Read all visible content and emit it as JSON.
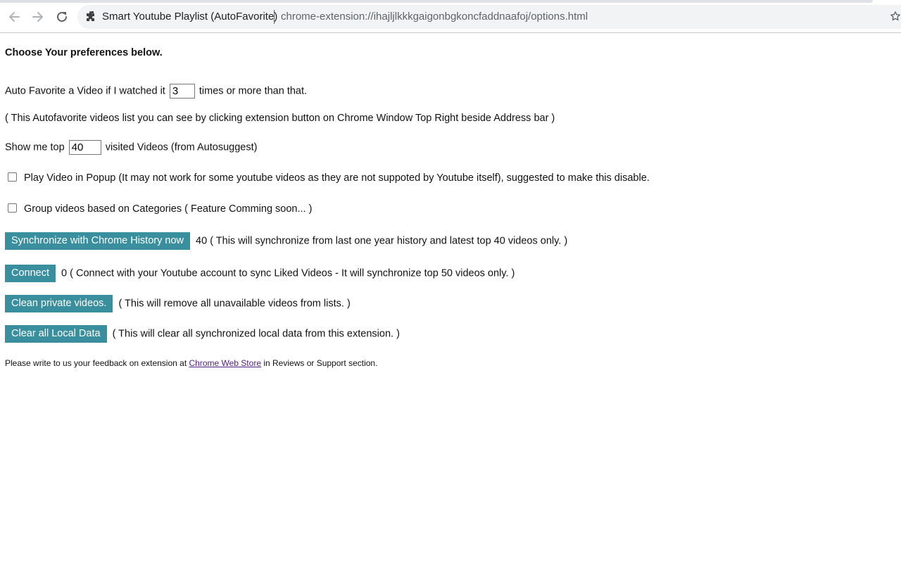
{
  "browser": {
    "site_name": "Smart Youtube Playlist (AutoFavorite)",
    "url": "chrome-extension://ihajljlkkkgaigonbgkoncfaddnaafoj/options.html",
    "icons": [
      "back-icon",
      "forward-icon",
      "reload-icon",
      "extension-icon",
      "bookmark-star-icon"
    ]
  },
  "page": {
    "heading": "Choose Your preferences below.",
    "auto_favorite": {
      "before": "Auto Favorite a Video if I watched it",
      "value": "3",
      "after": "times or more than that."
    },
    "note": "( This Autofavorite videos list you can see by clicking extension button on Chrome Window Top Right beside Address bar )",
    "show_top": {
      "before": "Show me top",
      "value": "40",
      "after": "visited Videos (from Autosuggest)"
    },
    "popup_option": {
      "checked": false,
      "label": "Play Video in Popup (It may not work for some youtube videos as they are not suppoted by Youtube itself), suggested to make this disable."
    },
    "group_option": {
      "checked": false,
      "label": "Group videos based on Categories ( Feature Comming soon... )"
    },
    "sync": {
      "button": "Synchronize with Chrome History now",
      "count": "40",
      "description": "( This will synchronize from last one year history and latest top 40 videos only. )"
    },
    "connect": {
      "button": "Connect",
      "count": "0",
      "description": "( Connect with your Youtube account to sync Liked Videos - It will synchronize top 50 videos only. )"
    },
    "clean": {
      "button": "Clean private videos.",
      "description": "( This will remove all unavailable videos from lists. )"
    },
    "clear": {
      "button": "Clear all Local Data",
      "description": "( This will clear all synchronized local data from this extension. )"
    },
    "feedback": {
      "before": "Please write to us your feedback on extension at",
      "link": "Chrome Web Store",
      "after": "in Reviews or Support section."
    }
  },
  "colors": {
    "button_bg": "#3a8f9e",
    "link": "#551a8b"
  }
}
